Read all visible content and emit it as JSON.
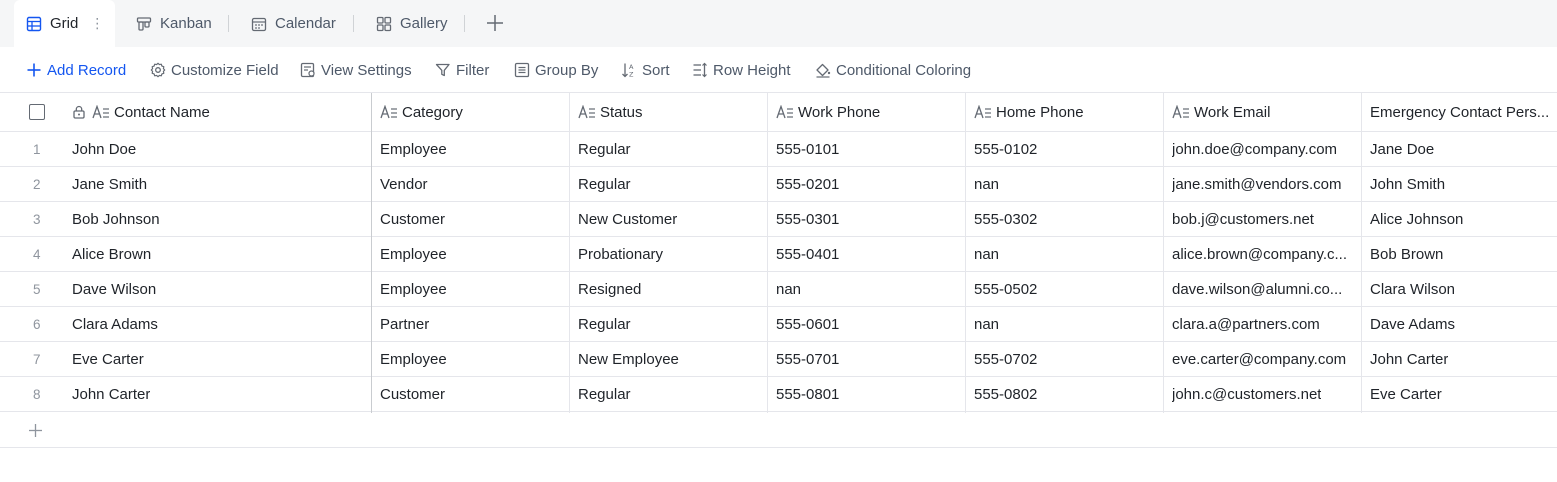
{
  "views": {
    "tabs": [
      {
        "label": "Grid",
        "icon": "grid-icon",
        "active": true
      },
      {
        "label": "Kanban",
        "icon": "kanban-icon",
        "active": false
      },
      {
        "label": "Calendar",
        "icon": "calendar-icon",
        "active": false
      },
      {
        "label": "Gallery",
        "icon": "gallery-icon",
        "active": false
      }
    ],
    "more_icon": "vertical-dots-icon",
    "add_view_icon": "plus-icon"
  },
  "toolbar": {
    "add_record": "Add Record",
    "customize_field": "Customize Field",
    "view_settings": "View Settings",
    "filter": "Filter",
    "group_by": "Group By",
    "sort": "Sort",
    "row_height": "Row Height",
    "conditional_coloring": "Conditional Coloring"
  },
  "colors": {
    "accent": "#1456f0",
    "tabbar_bg": "#f5f6f7",
    "border": "#e5e6eb",
    "muted_text": "#8f959e"
  },
  "table": {
    "columns": [
      "Contact Name",
      "Category",
      "Status",
      "Work Phone",
      "Home Phone",
      "Work Email",
      "Emergency Contact Pers..."
    ],
    "rows": [
      {
        "num": "1",
        "cells": [
          "John Doe",
          "Employee",
          "Regular",
          "555-0101",
          "555-0102",
          "john.doe@company.com",
          "Jane Doe"
        ]
      },
      {
        "num": "2",
        "cells": [
          "Jane Smith",
          "Vendor",
          "Regular",
          "555-0201",
          "nan",
          "jane.smith@vendors.com",
          "John Smith"
        ]
      },
      {
        "num": "3",
        "cells": [
          "Bob Johnson",
          "Customer",
          "New Customer",
          "555-0301",
          "555-0302",
          "bob.j@customers.net",
          "Alice Johnson"
        ]
      },
      {
        "num": "4",
        "cells": [
          "Alice Brown",
          "Employee",
          "Probationary",
          "555-0401",
          "nan",
          "alice.brown@company.c...",
          "Bob Brown"
        ]
      },
      {
        "num": "5",
        "cells": [
          "Dave Wilson",
          "Employee",
          "Resigned",
          "nan",
          "555-0502",
          "dave.wilson@alumni.co...",
          "Clara Wilson"
        ]
      },
      {
        "num": "6",
        "cells": [
          "Clara Adams",
          "Partner",
          "Regular",
          "555-0601",
          "nan",
          "clara.a@partners.com",
          "Dave Adams"
        ]
      },
      {
        "num": "7",
        "cells": [
          "Eve Carter",
          "Employee",
          "New Employee",
          "555-0701",
          "555-0702",
          "eve.carter@company.com",
          "John Carter"
        ]
      },
      {
        "num": "8",
        "cells": [
          "John Carter",
          "Customer",
          "Regular",
          "555-0801",
          "555-0802",
          "john.c@customers.net",
          "Eve Carter"
        ]
      }
    ]
  }
}
